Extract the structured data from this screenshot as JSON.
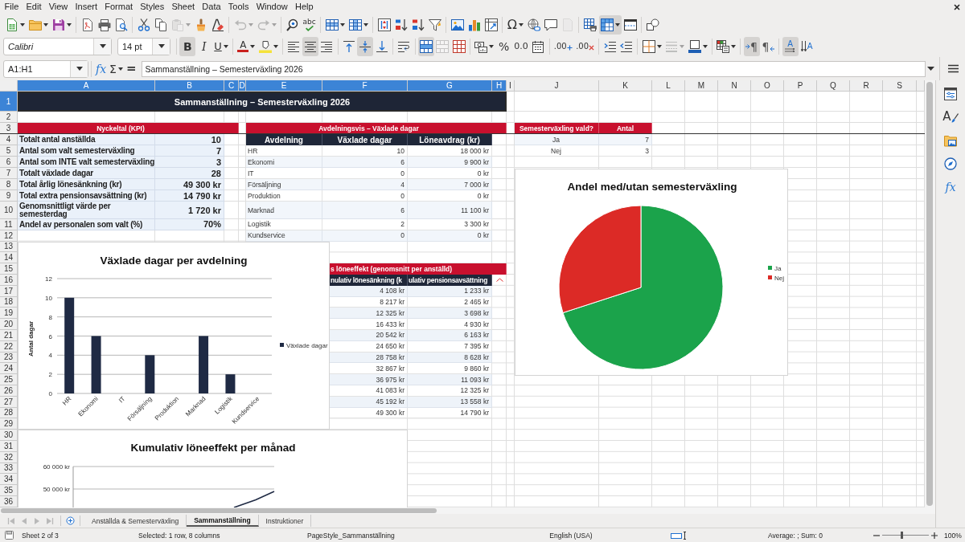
{
  "menu_bar": [
    "File",
    "Edit",
    "View",
    "Insert",
    "Format",
    "Styles",
    "Sheet",
    "Data",
    "Tools",
    "Window",
    "Help"
  ],
  "standard_toolbar": [
    [
      {
        "kind": "new",
        "on": false,
        "disabled": false,
        "dropdown": true
      },
      {
        "kind": "open",
        "on": false,
        "disabled": false,
        "dropdown": true
      },
      {
        "kind": "save",
        "on": false,
        "disabled": false,
        "dropdown": true
      }
    ],
    [
      {
        "kind": "export-pdf",
        "on": false,
        "disabled": false,
        "dropdown": false
      },
      {
        "kind": "print",
        "on": false,
        "disabled": false,
        "dropdown": false
      },
      {
        "kind": "print-preview",
        "on": false,
        "disabled": false,
        "dropdown": false
      }
    ],
    [
      {
        "kind": "cut",
        "on": false,
        "disabled": false,
        "dropdown": false
      },
      {
        "kind": "copy",
        "on": false,
        "disabled": false,
        "dropdown": false
      },
      {
        "kind": "paste",
        "on": false,
        "disabled": true,
        "dropdown": true
      },
      {
        "kind": "clone-formatting",
        "on": false,
        "disabled": false,
        "dropdown": false
      },
      {
        "kind": "clear-formatting",
        "on": false,
        "disabled": false,
        "dropdown": false
      }
    ],
    [
      {
        "kind": "undo",
        "on": false,
        "disabled": true,
        "dropdown": true
      },
      {
        "kind": "redo",
        "on": false,
        "disabled": true,
        "dropdown": true
      }
    ],
    [
      {
        "kind": "find-replace",
        "on": false,
        "disabled": false,
        "dropdown": false
      },
      {
        "kind": "spelling",
        "label": "abc",
        "on": false,
        "disabled": false,
        "dropdown": false
      }
    ],
    [
      {
        "kind": "rows",
        "on": false,
        "disabled": false,
        "dropdown": true
      },
      {
        "kind": "columns",
        "on": false,
        "disabled": false,
        "dropdown": true
      }
    ],
    [
      {
        "kind": "sort",
        "on": false,
        "disabled": false,
        "dropdown": false
      },
      {
        "kind": "sort-ascending",
        "on": false,
        "disabled": false,
        "dropdown": false
      },
      {
        "kind": "sort-descending",
        "on": false,
        "disabled": false,
        "dropdown": false
      },
      {
        "kind": "autofilter",
        "on": false,
        "disabled": false,
        "dropdown": false
      }
    ],
    [
      {
        "kind": "image",
        "on": false,
        "disabled": false,
        "dropdown": false
      },
      {
        "kind": "chart",
        "on": false,
        "disabled": false,
        "dropdown": false
      },
      {
        "kind": "pivot-table",
        "on": false,
        "disabled": false,
        "dropdown": false
      }
    ],
    [
      {
        "kind": "special-character",
        "label": "Ω",
        "on": false,
        "disabled": false,
        "dropdown": true
      },
      {
        "kind": "hyperlink",
        "on": false,
        "disabled": false,
        "dropdown": false
      },
      {
        "kind": "comment",
        "on": false,
        "disabled": false,
        "dropdown": false
      },
      {
        "kind": "header-footer",
        "on": false,
        "disabled": true,
        "dropdown": false
      }
    ],
    [
      {
        "kind": "print-area",
        "on": false,
        "disabled": false,
        "dropdown": false
      },
      {
        "kind": "freeze",
        "on": true,
        "disabled": false,
        "dropdown": true
      },
      {
        "kind": "split-window",
        "on": false,
        "disabled": false,
        "dropdown": false
      }
    ],
    [
      {
        "kind": "draw-functions",
        "on": false,
        "disabled": false,
        "dropdown": false
      }
    ]
  ],
  "formatting_toolbar": {
    "font_name": "Calibri",
    "font_size": "14 pt",
    "groups": [
      [
        {
          "kind": "bold",
          "label": "B",
          "on": true,
          "disabled": false,
          "dropdown": false
        },
        {
          "kind": "italic",
          "label": "I",
          "on": false,
          "disabled": false,
          "dropdown": false
        },
        {
          "kind": "underline",
          "label": "U",
          "on": false,
          "disabled": false,
          "dropdown": true
        }
      ],
      [
        {
          "kind": "font-color",
          "label": "A",
          "on": false,
          "disabled": false,
          "dropdown": true
        },
        {
          "kind": "highlight",
          "on": false,
          "disabled": false,
          "dropdown": true
        }
      ],
      [
        {
          "kind": "align-left",
          "on": false,
          "disabled": false,
          "dropdown": false
        },
        {
          "kind": "align-center",
          "on": true,
          "disabled": false,
          "dropdown": false
        },
        {
          "kind": "align-right",
          "on": false,
          "disabled": false,
          "dropdown": false
        }
      ],
      [
        {
          "kind": "align-top",
          "on": false,
          "disabled": false,
          "dropdown": false
        },
        {
          "kind": "align-middle",
          "on": true,
          "disabled": false,
          "dropdown": false
        },
        {
          "kind": "align-bottom",
          "on": false,
          "disabled": false,
          "dropdown": false
        }
      ],
      [
        {
          "kind": "wrap-text",
          "on": false,
          "disabled": false,
          "dropdown": false
        }
      ],
      [
        {
          "kind": "merge-center",
          "on": true,
          "disabled": false,
          "dropdown": false
        },
        {
          "kind": "merge-cells",
          "on": false,
          "disabled": true,
          "dropdown": false
        },
        {
          "kind": "unmerge",
          "on": false,
          "disabled": false,
          "dropdown": false
        }
      ],
      [
        {
          "kind": "currency",
          "on": false,
          "disabled": false,
          "dropdown": true
        },
        {
          "kind": "percent",
          "label": "%",
          "on": false,
          "disabled": false,
          "dropdown": false
        },
        {
          "kind": "number",
          "label": "0.0",
          "on": false,
          "disabled": false,
          "dropdown": false
        },
        {
          "kind": "date",
          "on": false,
          "disabled": false,
          "dropdown": false
        }
      ],
      [
        {
          "kind": "add-decimal",
          "label": ".00",
          "on": false,
          "disabled": false,
          "dropdown": false
        },
        {
          "kind": "delete-decimal",
          "label": ".00",
          "on": false,
          "disabled": false,
          "dropdown": false
        }
      ],
      [
        {
          "kind": "increase-indent",
          "on": false,
          "disabled": false,
          "dropdown": false
        },
        {
          "kind": "decrease-indent",
          "on": false,
          "disabled": false,
          "dropdown": false
        }
      ],
      [
        {
          "kind": "borders",
          "on": false,
          "disabled": false,
          "dropdown": true
        },
        {
          "kind": "border-style",
          "on": false,
          "disabled": true,
          "dropdown": true
        },
        {
          "kind": "border-color",
          "on": false,
          "disabled": false,
          "dropdown": true
        }
      ],
      [
        {
          "kind": "conditional",
          "on": false,
          "disabled": false,
          "dropdown": true
        }
      ],
      [
        {
          "kind": "ltr",
          "label": "¶",
          "on": true,
          "disabled": false,
          "dropdown": false
        },
        {
          "kind": "rtl",
          "label": "¶",
          "on": false,
          "disabled": false,
          "dropdown": false
        }
      ],
      [
        {
          "kind": "text-horizontal",
          "label": "A",
          "on": true,
          "disabled": false,
          "dropdown": false
        },
        {
          "kind": "text-vertical",
          "label": "A",
          "on": false,
          "disabled": false,
          "dropdown": false
        }
      ]
    ]
  },
  "formula_bar": {
    "name_box": "A1:H1",
    "buttons": [
      {
        "kind": "function-wizard",
        "label": "fx",
        "dropdown": false
      },
      {
        "kind": "sum",
        "label": "Σ",
        "dropdown": true
      },
      {
        "kind": "formula",
        "label": "=",
        "dropdown": false
      }
    ],
    "content": "Sammanställning – Semesterväxling 2026"
  },
  "sheet": {
    "columns": [
      {
        "label": "A",
        "selected": true
      },
      {
        "label": "B",
        "selected": true
      },
      {
        "label": "C",
        "selected": true
      },
      {
        "label": "D",
        "selected": true
      },
      {
        "label": "E",
        "selected": true
      },
      {
        "label": "F",
        "selected": true
      },
      {
        "label": "G",
        "selected": true
      },
      {
        "label": "H",
        "selected": true
      },
      {
        "label": "I",
        "selected": false
      },
      {
        "label": "J",
        "selected": false
      },
      {
        "label": "K",
        "selected": false
      },
      {
        "label": "L",
        "selected": false
      },
      {
        "label": "M",
        "selected": false
      },
      {
        "label": "N",
        "selected": false
      },
      {
        "label": "O",
        "selected": false
      },
      {
        "label": "P",
        "selected": false
      },
      {
        "label": "Q",
        "selected": false
      },
      {
        "label": "R",
        "selected": false
      },
      {
        "label": "S",
        "selected": false
      }
    ],
    "rows": [
      {
        "label": "1",
        "selected": true
      },
      {
        "label": "2",
        "selected": false
      },
      {
        "label": "3",
        "selected": false
      },
      {
        "label": "4",
        "selected": false
      },
      {
        "label": "5",
        "selected": false
      },
      {
        "label": "6",
        "selected": false
      },
      {
        "label": "7",
        "selected": false
      },
      {
        "label": "8",
        "selected": false
      },
      {
        "label": "9",
        "selected": false
      },
      {
        "label": "10",
        "selected": false
      },
      {
        "label": "11",
        "selected": false
      },
      {
        "label": "12",
        "selected": false
      },
      {
        "label": "13",
        "selected": false
      },
      {
        "label": "14",
        "selected": false
      },
      {
        "label": "15",
        "selected": false
      },
      {
        "label": "16",
        "selected": false
      },
      {
        "label": "17",
        "selected": false
      },
      {
        "label": "18",
        "selected": false
      },
      {
        "label": "19",
        "selected": false
      },
      {
        "label": "20",
        "selected": false
      },
      {
        "label": "21",
        "selected": false
      },
      {
        "label": "22",
        "selected": false
      },
      {
        "label": "23",
        "selected": false
      },
      {
        "label": "24",
        "selected": false
      },
      {
        "label": "25",
        "selected": false
      },
      {
        "label": "26",
        "selected": false
      },
      {
        "label": "27",
        "selected": false
      },
      {
        "label": "28",
        "selected": false
      },
      {
        "label": "29",
        "selected": false
      },
      {
        "label": "30",
        "selected": false
      },
      {
        "label": "31",
        "selected": false
      },
      {
        "label": "32",
        "selected": false
      },
      {
        "label": "33",
        "selected": false
      },
      {
        "label": "34",
        "selected": false
      },
      {
        "label": "35",
        "selected": false
      },
      {
        "label": "36",
        "selected": false
      }
    ],
    "title": {
      "text": "Sammanställning – Semesterväxling 2026",
      "selected": true
    },
    "kpi_table": {
      "header": "Nyckeltal (KPI)",
      "rows": [
        {
          "label": "Totalt antal anställda",
          "value": "10"
        },
        {
          "label": "Antal som valt semesterväxling",
          "value": "7"
        },
        {
          "label": "Antal som INTE valt semesterväxling",
          "value": "3"
        },
        {
          "label": "Totalt växlade dagar",
          "value": "28"
        },
        {
          "label": "Total årlig lönesänkning (kr)",
          "value": "49 300 kr"
        },
        {
          "label": "Total extra pensionsavsättning (kr)",
          "value": "14 790 kr"
        },
        {
          "label": "Genomsnittligt värde per semesterdag",
          "value": "1 720 kr"
        },
        {
          "label": "Andel av personalen som valt (%)",
          "value": "70%"
        }
      ]
    },
    "department_table": {
      "header": "Avdelningsvis – Växlade dagar",
      "columns": [
        "Avdelning",
        "Växlade dagar",
        "Löneavdrag (kr)"
      ],
      "rows": [
        [
          "HR",
          "10",
          "18 000 kr"
        ],
        [
          "Ekonomi",
          "6",
          "9 900 kr"
        ],
        [
          "IT",
          "0",
          "0 kr"
        ],
        [
          "Försäljning",
          "4",
          "7 000 kr"
        ],
        [
          "Produktion",
          "0",
          "0 kr"
        ],
        [
          "Marknad",
          "6",
          "11 100 kr"
        ],
        [
          "Logistik",
          "2",
          "3 300 kr"
        ],
        [
          "Kundservice",
          "0",
          "0 kr"
        ]
      ]
    },
    "choice_table": {
      "columns": [
        "Semesterväxling vald?",
        "Antal"
      ],
      "rows": [
        [
          "Ja",
          "7"
        ],
        [
          "Nej",
          "3"
        ]
      ]
    },
    "monthly_table": {
      "header": "s löneeffekt (genomsnitt per anställd)",
      "columns": [
        "nulativ lönesänkning (k",
        "ulativ pensionsavsättning"
      ],
      "rows": [
        [
          "4 108 kr",
          "1 233 kr"
        ],
        [
          "8 217 kr",
          "2 465 kr"
        ],
        [
          "12 325 kr",
          "3 698 kr"
        ],
        [
          "16 433 kr",
          "4 930 kr"
        ],
        [
          "20 542 kr",
          "6 163 kr"
        ],
        [
          "24 650 kr",
          "7 395 kr"
        ],
        [
          "28 758 kr",
          "8 628 kr"
        ],
        [
          "32 867 kr",
          "9 860 kr"
        ],
        [
          "36 975 kr",
          "11 093 kr"
        ],
        [
          "41 083 kr",
          "12 325 kr"
        ],
        [
          "45 192 kr",
          "13 558 kr"
        ],
        [
          "49 300 kr",
          "14 790 kr"
        ]
      ]
    },
    "bar_chart": {
      "chart_data": {
        "type": "bar",
        "title": "Växlade dagar per avdelning",
        "ylabel": "Antal dagar",
        "categories": [
          "HR",
          "Ekonomi",
          "IT",
          "Försäljning",
          "Produktion",
          "Marknad",
          "Logistik",
          "Kundservice"
        ],
        "series": [
          {
            "name": "Växlade dagar",
            "color": "#1f2a44",
            "values": [
              10,
              6,
              0,
              4,
              0,
              6,
              2,
              0
            ]
          }
        ],
        "ylim": [
          0,
          12
        ],
        "yticks": [
          0,
          2,
          4,
          6,
          8,
          10,
          12
        ],
        "grid": true,
        "legend": "right"
      }
    },
    "pie_chart": {
      "chart_data": {
        "type": "pie",
        "title": "Andel med/utan semesterväxling",
        "categories": [
          "Ja",
          "Nej"
        ],
        "values": [
          70,
          30
        ],
        "colors": [
          "#1ba34b",
          "#dc2a26"
        ],
        "legend": "right"
      }
    },
    "line_chart": {
      "title": "Kumulativ löneeffekt per månad",
      "tick_labels": [
        "60 000 kr",
        "50 000 kr"
      ]
    }
  },
  "sidebar": [
    {
      "kind": "properties"
    },
    {
      "kind": "styles",
      "label": "A"
    },
    {
      "kind": "gallery"
    },
    {
      "kind": "navigator"
    },
    {
      "kind": "functions",
      "label": "fx"
    }
  ],
  "sheet_navigation": [
    {
      "kind": "first",
      "disabled": true
    },
    {
      "kind": "previous",
      "disabled": true
    },
    {
      "kind": "next",
      "disabled": true
    },
    {
      "kind": "last",
      "disabled": true
    }
  ],
  "sheet_tabs": [
    {
      "label": "Anställda & Semesterväxling",
      "selected": false
    },
    {
      "label": "Sammanställning",
      "selected": true
    },
    {
      "label": "Instruktioner",
      "selected": false
    }
  ],
  "status_bar": {
    "sheet": "Sheet 2 of 3",
    "selection": "Selected: 1 row, 8 columns",
    "page_style": "PageStyle_Sammanställning",
    "language": "English (USA)",
    "summary": "Average: ; Sum: 0",
    "zoom": {
      "level": 0.42,
      "reading": "100%"
    }
  }
}
